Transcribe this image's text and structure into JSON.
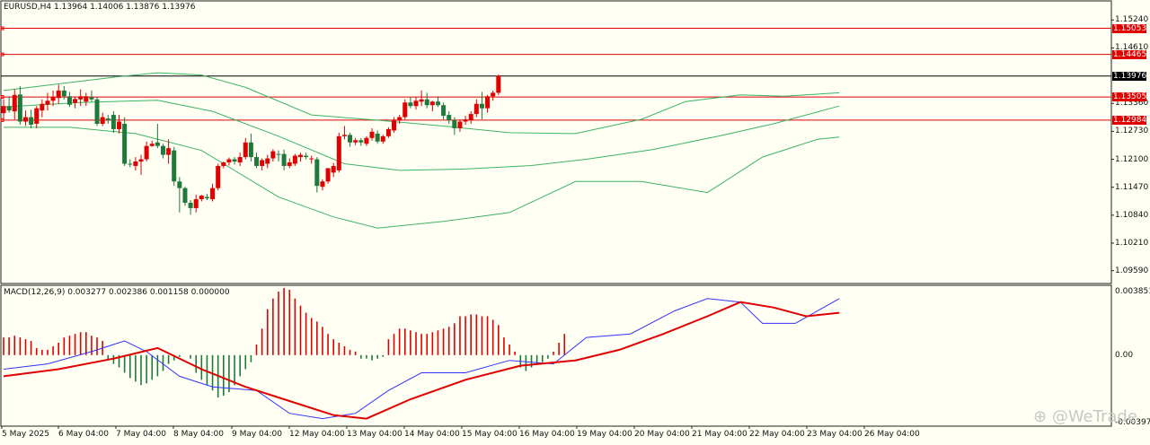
{
  "main_header": {
    "symbol_tf": "EURUSD,H4",
    "ohlc": "1.13964 1.14006 1.13876 1.13976"
  },
  "macd_header": "MACD(12,26,9) 0.003277 0.002386 0.001158 0.000000",
  "price_axis": [
    "1.15240",
    "1.14610",
    "1.13360",
    "1.12730",
    "1.12100",
    "1.11470",
    "1.10840",
    "1.10210",
    "1.09590"
  ],
  "level_labels": [
    {
      "text": "1.15053",
      "color": "red"
    },
    {
      "text": "1.14465",
      "color": "red"
    },
    {
      "text": "1.13976",
      "color": "black"
    },
    {
      "text": "1.13505",
      "color": "red"
    },
    {
      "text": "1.12984",
      "color": "red"
    }
  ],
  "macd_axis": [
    "0.003851",
    "0.00",
    "-0.003974"
  ],
  "date_axis": [
    "5 May 2025",
    "6 May 04:00",
    "7 May 04:00",
    "8 May 04:00",
    "9 May 04:00",
    "12 May 04:00",
    "13 May 04:00",
    "14 May 04:00",
    "15 May 04:00",
    "16 May 04:00",
    "19 May 04:00",
    "20 May 04:00",
    "21 May 04:00",
    "22 May 04:00",
    "23 May 04:00",
    "26 May 04:00"
  ],
  "watermark": "@WeTrade",
  "colors": {
    "bull": "#e00000",
    "bear": "#1e7a3a",
    "band": "#3cb464",
    "macd_line": "#3333ff",
    "signal_line": "#e00000",
    "level_line": "#e00000",
    "background": "#fffff4"
  },
  "chart_data": [
    {
      "type": "candlestick",
      "title": "EURUSD,H4",
      "ylim": [
        1.093,
        1.1565
      ],
      "horizontal_levels": [
        1.15053,
        1.14465,
        1.13976,
        1.13505,
        1.12984
      ],
      "candles": [
        {
          "o": 1.1314,
          "h": 1.1345,
          "l": 1.13,
          "c": 1.133
        },
        {
          "o": 1.133,
          "h": 1.1352,
          "l": 1.1315,
          "c": 1.132
        },
        {
          "o": 1.1318,
          "h": 1.1368,
          "l": 1.13,
          "c": 1.1355
        },
        {
          "o": 1.1356,
          "h": 1.1375,
          "l": 1.1288,
          "c": 1.1295
        },
        {
          "o": 1.1295,
          "h": 1.132,
          "l": 1.1285,
          "c": 1.1305
        },
        {
          "o": 1.1305,
          "h": 1.1322,
          "l": 1.128,
          "c": 1.1288
        },
        {
          "o": 1.129,
          "h": 1.133,
          "l": 1.128,
          "c": 1.1325
        },
        {
          "o": 1.132,
          "h": 1.1345,
          "l": 1.1305,
          "c": 1.1335
        },
        {
          "o": 1.1333,
          "h": 1.136,
          "l": 1.132,
          "c": 1.1342
        },
        {
          "o": 1.1342,
          "h": 1.1365,
          "l": 1.133,
          "c": 1.135
        },
        {
          "o": 1.1348,
          "h": 1.1378,
          "l": 1.1335,
          "c": 1.1365
        },
        {
          "o": 1.1365,
          "h": 1.1375,
          "l": 1.1345,
          "c": 1.1352
        },
        {
          "o": 1.1352,
          "h": 1.1362,
          "l": 1.1328,
          "c": 1.1333
        },
        {
          "o": 1.1337,
          "h": 1.1352,
          "l": 1.1325,
          "c": 1.1346
        },
        {
          "o": 1.1345,
          "h": 1.1368,
          "l": 1.133,
          "c": 1.1352
        },
        {
          "o": 1.134,
          "h": 1.136,
          "l": 1.133,
          "c": 1.1352
        },
        {
          "o": 1.135,
          "h": 1.1365,
          "l": 1.134,
          "c": 1.1345
        },
        {
          "o": 1.1345,
          "h": 1.135,
          "l": 1.1285,
          "c": 1.129
        },
        {
          "o": 1.129,
          "h": 1.1315,
          "l": 1.1285,
          "c": 1.1305
        },
        {
          "o": 1.1302,
          "h": 1.131,
          "l": 1.129,
          "c": 1.1298
        },
        {
          "o": 1.131,
          "h": 1.1318,
          "l": 1.127,
          "c": 1.1278
        },
        {
          "o": 1.1278,
          "h": 1.131,
          "l": 1.1268,
          "c": 1.1295
        },
        {
          "o": 1.129,
          "h": 1.1305,
          "l": 1.1195,
          "c": 1.12
        },
        {
          "o": 1.12,
          "h": 1.121,
          "l": 1.1192,
          "c": 1.1198
        },
        {
          "o": 1.1195,
          "h": 1.1215,
          "l": 1.1185,
          "c": 1.1205
        },
        {
          "o": 1.1205,
          "h": 1.122,
          "l": 1.1175,
          "c": 1.121
        },
        {
          "o": 1.121,
          "h": 1.125,
          "l": 1.1205,
          "c": 1.124
        },
        {
          "o": 1.124,
          "h": 1.1252,
          "l": 1.1238,
          "c": 1.1245
        },
        {
          "o": 1.1248,
          "h": 1.129,
          "l": 1.1235,
          "c": 1.124
        },
        {
          "o": 1.124,
          "h": 1.1245,
          "l": 1.1212,
          "c": 1.122
        },
        {
          "o": 1.122,
          "h": 1.1255,
          "l": 1.12,
          "c": 1.1235
        },
        {
          "o": 1.123,
          "h": 1.1238,
          "l": 1.115,
          "c": 1.116
        },
        {
          "o": 1.116,
          "h": 1.117,
          "l": 1.109,
          "c": 1.1145
        },
        {
          "o": 1.1145,
          "h": 1.1148,
          "l": 1.1105,
          "c": 1.1112
        },
        {
          "o": 1.1112,
          "h": 1.1118,
          "l": 1.1085,
          "c": 1.11
        },
        {
          "o": 1.11,
          "h": 1.113,
          "l": 1.109,
          "c": 1.112
        },
        {
          "o": 1.112,
          "h": 1.113,
          "l": 1.1115,
          "c": 1.1128
        },
        {
          "o": 1.1125,
          "h": 1.1132,
          "l": 1.1118,
          "c": 1.1122
        },
        {
          "o": 1.112,
          "h": 1.1155,
          "l": 1.1115,
          "c": 1.1145
        },
        {
          "o": 1.1145,
          "h": 1.12,
          "l": 1.114,
          "c": 1.1195
        },
        {
          "o": 1.1195,
          "h": 1.1205,
          "l": 1.119,
          "c": 1.1203
        },
        {
          "o": 1.1203,
          "h": 1.1214,
          "l": 1.1196,
          "c": 1.121
        },
        {
          "o": 1.121,
          "h": 1.1215,
          "l": 1.1198,
          "c": 1.1205
        },
        {
          "o": 1.1203,
          "h": 1.1225,
          "l": 1.1195,
          "c": 1.1215
        },
        {
          "o": 1.1215,
          "h": 1.1258,
          "l": 1.121,
          "c": 1.1248
        },
        {
          "o": 1.1248,
          "h": 1.1268,
          "l": 1.1205,
          "c": 1.1215
        },
        {
          "o": 1.1215,
          "h": 1.1225,
          "l": 1.119,
          "c": 1.1195
        },
        {
          "o": 1.1195,
          "h": 1.1212,
          "l": 1.1185,
          "c": 1.1208
        },
        {
          "o": 1.12,
          "h": 1.122,
          "l": 1.119,
          "c": 1.1212
        },
        {
          "o": 1.1212,
          "h": 1.1233,
          "l": 1.1205,
          "c": 1.1228
        },
        {
          "o": 1.1222,
          "h": 1.123,
          "l": 1.1205,
          "c": 1.122
        },
        {
          "o": 1.1222,
          "h": 1.1232,
          "l": 1.1185,
          "c": 1.1195
        },
        {
          "o": 1.1195,
          "h": 1.1212,
          "l": 1.119,
          "c": 1.1203
        },
        {
          "o": 1.12,
          "h": 1.1222,
          "l": 1.1195,
          "c": 1.1218
        },
        {
          "o": 1.1215,
          "h": 1.1225,
          "l": 1.1205,
          "c": 1.122
        },
        {
          "o": 1.1218,
          "h": 1.1225,
          "l": 1.121,
          "c": 1.1215
        },
        {
          "o": 1.121,
          "h": 1.1218,
          "l": 1.12,
          "c": 1.1212
        },
        {
          "o": 1.121,
          "h": 1.1215,
          "l": 1.1135,
          "c": 1.115
        },
        {
          "o": 1.1148,
          "h": 1.1165,
          "l": 1.114,
          "c": 1.116
        },
        {
          "o": 1.116,
          "h": 1.1185,
          "l": 1.1155,
          "c": 1.119
        },
        {
          "o": 1.118,
          "h": 1.1202,
          "l": 1.117,
          "c": 1.1195
        },
        {
          "o": 1.1185,
          "h": 1.127,
          "l": 1.118,
          "c": 1.1262
        },
        {
          "o": 1.1262,
          "h": 1.1285,
          "l": 1.1255,
          "c": 1.1265
        },
        {
          "o": 1.1265,
          "h": 1.127,
          "l": 1.1238,
          "c": 1.1248
        },
        {
          "o": 1.1248,
          "h": 1.1258,
          "l": 1.1242,
          "c": 1.1253
        },
        {
          "o": 1.1253,
          "h": 1.1258,
          "l": 1.124,
          "c": 1.1248
        },
        {
          "o": 1.1245,
          "h": 1.1262,
          "l": 1.124,
          "c": 1.1258
        },
        {
          "o": 1.1258,
          "h": 1.128,
          "l": 1.1252,
          "c": 1.1272
        },
        {
          "o": 1.1268,
          "h": 1.1275,
          "l": 1.1245,
          "c": 1.125
        },
        {
          "o": 1.125,
          "h": 1.1265,
          "l": 1.1245,
          "c": 1.1262
        },
        {
          "o": 1.1262,
          "h": 1.1282,
          "l": 1.1258,
          "c": 1.1278
        },
        {
          "o": 1.1275,
          "h": 1.1305,
          "l": 1.127,
          "c": 1.1298
        },
        {
          "o": 1.1298,
          "h": 1.131,
          "l": 1.129,
          "c": 1.1305
        },
        {
          "o": 1.1305,
          "h": 1.1345,
          "l": 1.13,
          "c": 1.1338
        },
        {
          "o": 1.1338,
          "h": 1.135,
          "l": 1.1325,
          "c": 1.133
        },
        {
          "o": 1.133,
          "h": 1.135,
          "l": 1.1322,
          "c": 1.1342
        },
        {
          "o": 1.134,
          "h": 1.1365,
          "l": 1.133,
          "c": 1.1345
        },
        {
          "o": 1.1345,
          "h": 1.136,
          "l": 1.1325,
          "c": 1.1332
        },
        {
          "o": 1.1332,
          "h": 1.1342,
          "l": 1.1318,
          "c": 1.134
        },
        {
          "o": 1.134,
          "h": 1.1352,
          "l": 1.1328,
          "c": 1.1332
        },
        {
          "o": 1.1332,
          "h": 1.1338,
          "l": 1.13,
          "c": 1.1308
        },
        {
          "o": 1.131,
          "h": 1.1318,
          "l": 1.129,
          "c": 1.1298
        },
        {
          "o": 1.1298,
          "h": 1.1305,
          "l": 1.1265,
          "c": 1.128
        },
        {
          "o": 1.128,
          "h": 1.13,
          "l": 1.1272,
          "c": 1.1295
        },
        {
          "o": 1.1295,
          "h": 1.1308,
          "l": 1.1288,
          "c": 1.13
        },
        {
          "o": 1.1298,
          "h": 1.1318,
          "l": 1.129,
          "c": 1.1312
        },
        {
          "o": 1.1312,
          "h": 1.1345,
          "l": 1.1305,
          "c": 1.1335
        },
        {
          "o": 1.1335,
          "h": 1.1362,
          "l": 1.13,
          "c": 1.1325
        },
        {
          "o": 1.1325,
          "h": 1.1355,
          "l": 1.1315,
          "c": 1.1352
        },
        {
          "o": 1.1352,
          "h": 1.1365,
          "l": 1.1342,
          "c": 1.136
        },
        {
          "o": 1.136,
          "h": 1.1401,
          "l": 1.1355,
          "c": 1.1398
        }
      ],
      "bollinger": {
        "upper": [
          [
            0,
            1.1365
          ],
          [
            10,
            1.138
          ],
          [
            20,
            1.1395
          ],
          [
            28,
            1.1405
          ],
          [
            36,
            1.14
          ],
          [
            44,
            1.1372
          ],
          [
            56,
            1.131
          ],
          [
            68,
            1.1298
          ],
          [
            80,
            1.1285
          ],
          [
            92,
            1.127
          ],
          [
            104,
            1.1268
          ],
          [
            116,
            1.13
          ],
          [
            124,
            1.134
          ],
          [
            134,
            1.1355
          ],
          [
            142,
            1.1352
          ],
          [
            152,
            1.136
          ]
        ],
        "middle": [
          [
            0,
            1.1328
          ],
          [
            14,
            1.1338
          ],
          [
            28,
            1.1343
          ],
          [
            38,
            1.1318
          ],
          [
            50,
            1.1262
          ],
          [
            62,
            1.12
          ],
          [
            72,
            1.1185
          ],
          [
            84,
            1.1188
          ],
          [
            96,
            1.1196
          ],
          [
            106,
            1.121
          ],
          [
            118,
            1.1232
          ],
          [
            130,
            1.1262
          ],
          [
            140,
            1.129
          ],
          [
            152,
            1.133
          ]
        ],
        "lower": [
          [
            0,
            1.1282
          ],
          [
            12,
            1.1282
          ],
          [
            24,
            1.1268
          ],
          [
            36,
            1.123
          ],
          [
            50,
            1.1125
          ],
          [
            60,
            1.108
          ],
          [
            68,
            1.1055
          ],
          [
            80,
            1.107
          ],
          [
            92,
            1.109
          ],
          [
            104,
            1.116
          ],
          [
            116,
            1.116
          ],
          [
            128,
            1.1135
          ],
          [
            138,
            1.1215
          ],
          [
            148,
            1.1255
          ],
          [
            152,
            1.126
          ]
        ]
      }
    },
    {
      "type": "bar",
      "title": "MACD(12,26,9)",
      "ylim": [
        -0.003974,
        0.003851
      ],
      "histogram": [
        0.001,
        0.001,
        0.0011,
        0.001,
        0.0009,
        0.0008,
        0.0004,
        0.0003,
        0.0003,
        0.0005,
        0.0007,
        0.001,
        0.0011,
        0.0012,
        0.0013,
        0.0013,
        0.0011,
        0.001,
        0.0008,
        -0.0003,
        -0.0005,
        -0.0007,
        -0.001,
        -0.0013,
        -0.0015,
        -0.0017,
        -0.0016,
        -0.0014,
        -0.0012,
        -0.0009,
        -0.0005,
        -0.0003,
        -0.0001,
        0.0,
        -0.0002,
        -0.001,
        -0.0014,
        -0.0017,
        -0.002,
        -0.0024,
        -0.0023,
        -0.0021,
        -0.0017,
        -0.0012,
        -0.0008,
        -0.0004,
        0.0006,
        0.0015,
        0.0026,
        0.0032,
        0.0036,
        0.0038,
        0.0037,
        0.0032,
        0.0028,
        0.0024,
        0.0021,
        0.0019,
        0.0016,
        0.0012,
        0.0009,
        0.0007,
        0.0005,
        0.0003,
        0.0002,
        -0.0002,
        -0.0002,
        -0.0003,
        -0.0002,
        -0.0001,
        0.0009,
        0.0012,
        0.0015,
        0.0015,
        0.0014,
        0.0013,
        0.0012,
        0.0012,
        0.0013,
        0.0014,
        0.0015,
        0.0016,
        0.0018,
        0.0022,
        0.0022,
        0.0023,
        0.0023,
        0.0022,
        0.0022,
        0.002,
        0.0017,
        0.001,
        0.0006,
        0.0002,
        -0.0007,
        -0.0009,
        -0.0007,
        -0.0005,
        -0.0004,
        -0.0002,
        0.0002,
        0.0007,
        0.0012
      ],
      "macd_line": [
        [
          0,
          -0.0008
        ],
        [
          8,
          -0.0005
        ],
        [
          16,
          0.0002
        ],
        [
          22,
          0.0008
        ],
        [
          26,
          0.0002
        ],
        [
          32,
          -0.0012
        ],
        [
          38,
          -0.0018
        ],
        [
          46,
          -0.002
        ],
        [
          52,
          -0.0033
        ],
        [
          58,
          -0.0036
        ],
        [
          64,
          -0.0033
        ],
        [
          70,
          -0.002
        ],
        [
          76,
          -0.001
        ],
        [
          84,
          -0.001
        ],
        [
          92,
          -0.0003
        ],
        [
          100,
          -0.0005
        ],
        [
          106,
          0.001
        ],
        [
          114,
          0.0012
        ],
        [
          122,
          0.0025
        ],
        [
          128,
          0.0032
        ],
        [
          134,
          0.003
        ],
        [
          138,
          0.0018
        ],
        [
          144,
          0.0018
        ],
        [
          152,
          0.0032
        ]
      ],
      "signal_line": [
        [
          0,
          -0.0012
        ],
        [
          10,
          -0.0008
        ],
        [
          20,
          -0.0002
        ],
        [
          28,
          0.0004
        ],
        [
          36,
          -0.0008
        ],
        [
          44,
          -0.0018
        ],
        [
          52,
          -0.0026
        ],
        [
          60,
          -0.0034
        ],
        [
          66,
          -0.0036
        ],
        [
          74,
          -0.0025
        ],
        [
          84,
          -0.0014
        ],
        [
          94,
          -0.0006
        ],
        [
          104,
          -0.0003
        ],
        [
          112,
          0.0003
        ],
        [
          120,
          0.0012
        ],
        [
          128,
          0.0022
        ],
        [
          134,
          0.003
        ],
        [
          140,
          0.0027
        ],
        [
          146,
          0.0022
        ],
        [
          152,
          0.0024
        ]
      ]
    }
  ]
}
